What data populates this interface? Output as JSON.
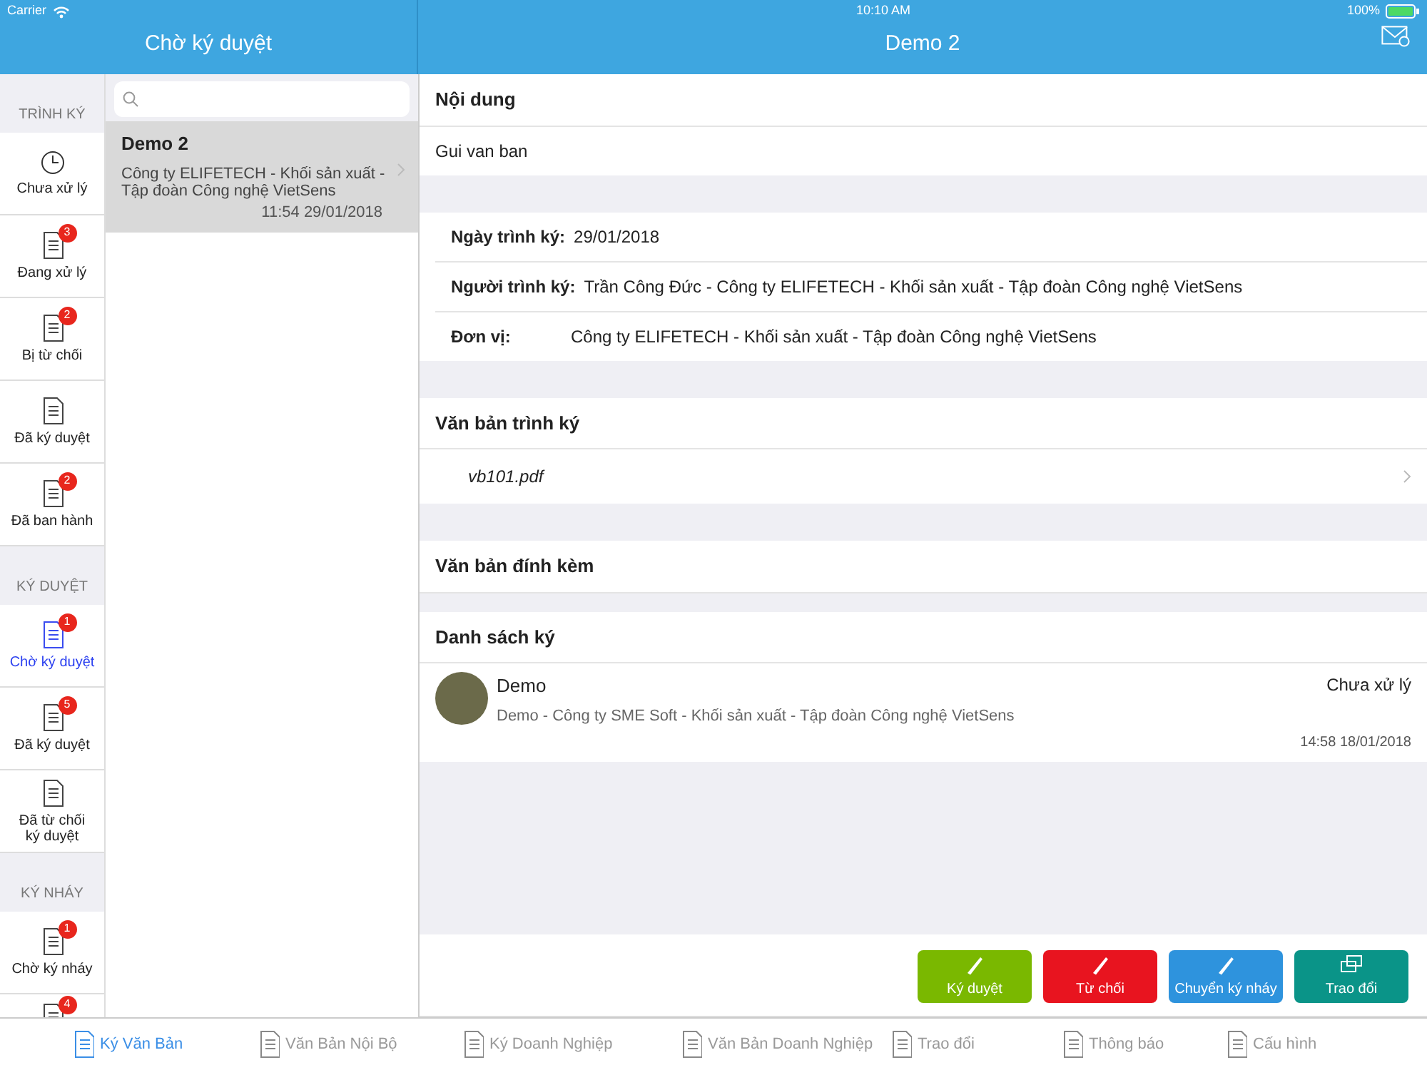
{
  "status_bar": {
    "carrier": "Carrier",
    "time": "10:10 AM",
    "battery": "100%"
  },
  "list_header": {
    "title": "Chờ ký duyệt"
  },
  "detail_header": {
    "title": "Demo 2"
  },
  "sidebar": {
    "sections": [
      {
        "title": "TRÌNH KÝ",
        "items": [
          {
            "label": "Chưa xử lý",
            "kind": "clock",
            "selected": false
          },
          {
            "label": "Đang xử lý",
            "kind": "document",
            "badge": "3",
            "selected": false
          },
          {
            "label": "Bị từ chối",
            "kind": "document",
            "badge": "2",
            "selected": false
          },
          {
            "label": "Đã ký duyệt",
            "kind": "document",
            "selected": false
          },
          {
            "label": "Đã ban hành",
            "kind": "document",
            "badge": "2",
            "selected": false
          }
        ]
      },
      {
        "title": "KÝ DUYỆT",
        "items": [
          {
            "label": "Chờ ký duyệt",
            "kind": "document",
            "badge": "1",
            "selected": true
          },
          {
            "label": "Đã ký duyệt",
            "kind": "document",
            "badge": "5",
            "selected": false
          },
          {
            "label": "Đã từ chối ký duyệt",
            "kind": "document",
            "selected": false
          }
        ]
      },
      {
        "title": "KÝ NHÁY",
        "items": [
          {
            "label": "Chờ ký nháy",
            "kind": "document",
            "badge": "1",
            "selected": false
          },
          {
            "kind": "document",
            "badge": "4",
            "selected": false
          }
        ]
      }
    ]
  },
  "documents": [
    {
      "title": "Demo 2",
      "org": "Công ty ELIFETECH - Khối sản xuất - Tập đoàn Công nghệ VietSens",
      "time": "11:54 29/01/2018",
      "selected": true
    }
  ],
  "detail": {
    "content_title": "Nội dung",
    "content": "Gui van ban",
    "fields": [
      {
        "label": "Ngày trình ký:",
        "value": "29/01/2018"
      },
      {
        "label": "Người trình ký:",
        "value": "Trần Công Đức - Công ty ELIFETECH - Khối sản xuất - Tập đoàn Công nghệ VietSens"
      },
      {
        "label": "Đơn vị:",
        "value": "Công ty ELIFETECH - Khối sản xuất - Tập đoàn Công nghệ VietSens"
      }
    ],
    "files_title": "Văn bản trình ký",
    "files": [
      "vb101.pdf"
    ],
    "attachments_title": "Văn bản đính kèm",
    "signers_title": "Danh sách ký",
    "signers": [
      {
        "name": "Demo",
        "status": "Chưa xử lý",
        "org": "Demo - Công ty SME Soft - Khối sản xuất - Tập đoàn Công nghệ VietSens",
        "time": "14:58 18/01/2018"
      }
    ]
  },
  "actions": [
    {
      "label": "Ký duyệt",
      "color": "#7ab800"
    },
    {
      "label": "Từ chối",
      "color": "#e8141f"
    },
    {
      "label": "Chuyển ký nháy",
      "color": "#2e93dd"
    },
    {
      "label": "Trao đổi",
      "color": "#0a9488"
    }
  ],
  "tabs": [
    {
      "label": "Ký Văn Bản",
      "selected": true
    },
    {
      "label": "Văn Bản Nội Bộ",
      "selected": false
    },
    {
      "label": "Ký Doanh Nghiệp",
      "selected": false
    },
    {
      "label": "Văn Bản Doanh Nghiệp",
      "selected": false
    },
    {
      "label": "Trao đổi",
      "selected": false
    },
    {
      "label": "Thông báo",
      "selected": false
    },
    {
      "label": "Cấu hình",
      "selected": false
    }
  ]
}
